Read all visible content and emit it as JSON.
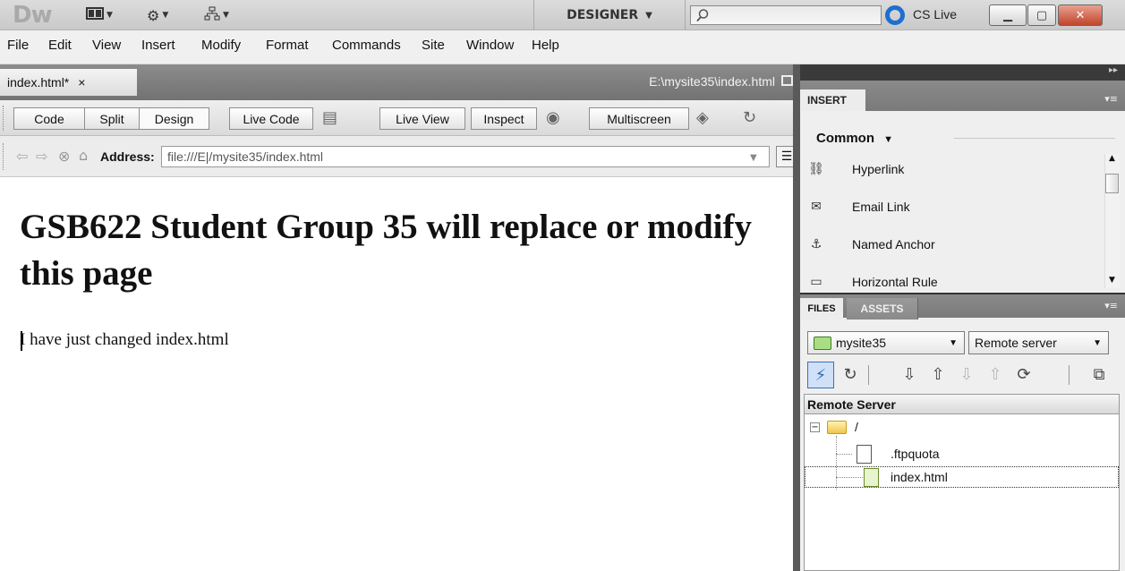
{
  "appbar": {
    "logo": "Dw",
    "workspace": "DESIGNER",
    "search_placeholder": "",
    "cslive": "CS Live"
  },
  "menu": [
    "File",
    "Edit",
    "View",
    "Insert",
    "Modify",
    "Format",
    "Commands",
    "Site",
    "Window",
    "Help"
  ],
  "doc": {
    "tab_label": "index.html*",
    "tab_close": "×",
    "path": "E:\\mysite35\\index.html"
  },
  "doctoolbar": {
    "code": "Code",
    "split": "Split",
    "design": "Design",
    "live_code": "Live Code",
    "live_view": "Live View",
    "inspect": "Inspect",
    "multiscreen": "Multiscreen"
  },
  "address": {
    "label": "Address:",
    "value": "file:///E|/mysite35/index.html"
  },
  "page": {
    "heading": "GSB622 Student Group 35 will replace or modify this page",
    "paragraph": "I have just changed index.html"
  },
  "insert_panel": {
    "tab": "INSERT",
    "category": "Common",
    "items": [
      {
        "label": "Hyperlink",
        "icon": "hyperlink-icon"
      },
      {
        "label": "Email Link",
        "icon": "email-link-icon"
      },
      {
        "label": "Named Anchor",
        "icon": "named-anchor-icon"
      },
      {
        "label": "Horizontal Rule",
        "icon": "horizontal-rule-icon"
      }
    ]
  },
  "files_panel": {
    "tabs": [
      "FILES",
      "ASSETS"
    ],
    "site": "mysite35",
    "view": "Remote server",
    "tree_header": "Remote Server",
    "root": "/",
    "files": [
      ".ftpquota",
      "index.html"
    ],
    "selected_file": "index.html"
  },
  "colors": {
    "accent_blue": "#1d6fd0",
    "close_red": "#c0452b",
    "dock_dark": "#3a3a3a"
  }
}
